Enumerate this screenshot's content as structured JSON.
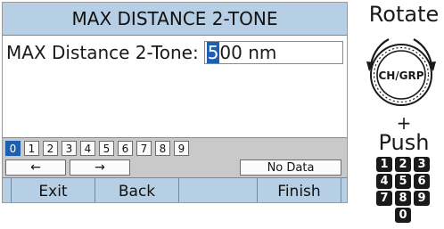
{
  "screen": {
    "title": "MAX DISTANCE 2-TONE",
    "field_label": "MAX Distance 2-Tone:",
    "field_value_cursor": "5",
    "field_value_rest": "00 nm",
    "digits": [
      "0",
      "1",
      "2",
      "3",
      "4",
      "5",
      "6",
      "7",
      "8",
      "9"
    ],
    "left_arrow": "←",
    "right_arrow": "→",
    "no_data": "No Data",
    "softkeys": {
      "exit": "Exit",
      "back": "Back",
      "finish": "Finish"
    }
  },
  "controls": {
    "rotate_label": "Rotate",
    "knob_label": "CH/GRP",
    "plus": "+",
    "push_label": "Push",
    "numpad": [
      "1",
      "2",
      "3",
      "4",
      "5",
      "6",
      "7",
      "8",
      "9",
      "0"
    ]
  },
  "colors": {
    "bar": "#b7cfe4",
    "highlight": "#1d5fb0",
    "keypad_bg": "#c9c9c9"
  }
}
